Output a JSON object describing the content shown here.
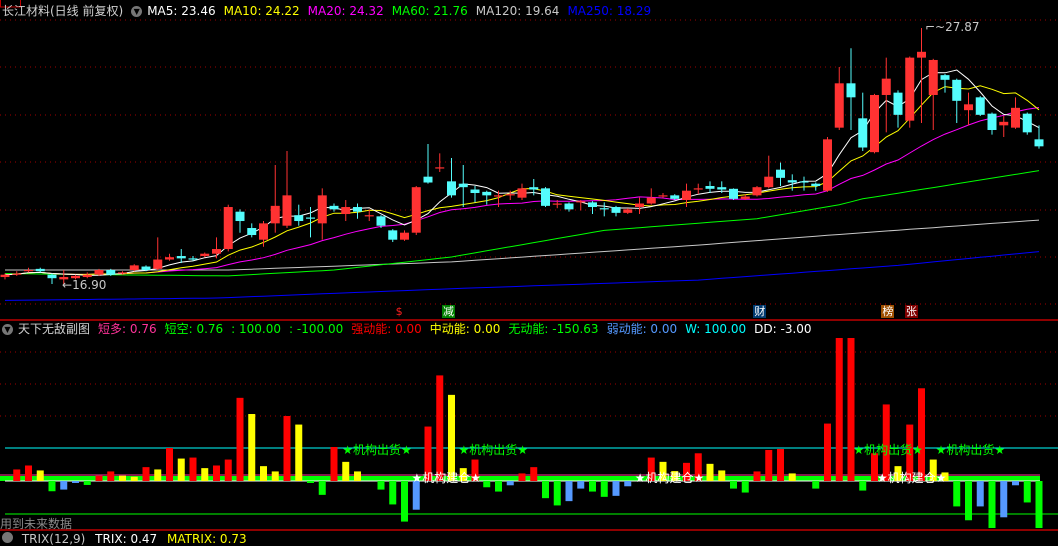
{
  "main": {
    "title": "长江材料(日线 前复权)",
    "ma": [
      {
        "label": "MA5: 23.46",
        "color": "#ffffff"
      },
      {
        "label": "MA10: 24.22",
        "color": "#ffff00"
      },
      {
        "label": "MA20: 24.32",
        "color": "#ff00ff"
      },
      {
        "label": "MA60: 21.76",
        "color": "#00ff00"
      },
      {
        "label": "MA120: 19.64",
        "color": "#c8c8c8"
      },
      {
        "label": "MA250: 18.29",
        "color": "#0000ff"
      }
    ],
    "high_label": "27.87",
    "low_label": "16.90",
    "high_index": 78,
    "high_value": 27.87,
    "low_index": 4,
    "low_value": 16.9,
    "price_range": [
      15.6,
      28.8
    ],
    "candles": [
      [
        17.2,
        17.3,
        17.35,
        17.1
      ],
      [
        17.3,
        17.35,
        17.45,
        17.25
      ],
      [
        17.45,
        17.5,
        17.6,
        17.4
      ],
      [
        17.55,
        17.45,
        17.6,
        17.4
      ],
      [
        17.3,
        17.15,
        17.35,
        16.9
      ],
      [
        17.1,
        17.2,
        17.5,
        16.9
      ],
      [
        17.15,
        17.25,
        17.3,
        17.1
      ],
      [
        17.2,
        17.3,
        17.4,
        17.15
      ],
      [
        17.3,
        17.5,
        17.55,
        17.25
      ],
      [
        17.5,
        17.3,
        17.55,
        17.25
      ],
      [
        17.35,
        17.4,
        17.45,
        17.3
      ],
      [
        17.5,
        17.7,
        17.75,
        17.45
      ],
      [
        17.65,
        17.5,
        17.7,
        17.45
      ],
      [
        17.55,
        17.95,
        18.9,
        17.5
      ],
      [
        17.95,
        18.05,
        18.2,
        17.9
      ],
      [
        18.1,
        18.0,
        18.4,
        17.8
      ],
      [
        18.0,
        17.95,
        18.1,
        17.9
      ],
      [
        18.1,
        18.2,
        18.25,
        18.05
      ],
      [
        18.2,
        18.4,
        18.9,
        18.0
      ],
      [
        18.4,
        20.2,
        20.3,
        18.3
      ],
      [
        20.0,
        19.6,
        20.1,
        19.1
      ],
      [
        19.3,
        19.0,
        19.5,
        18.9
      ],
      [
        18.8,
        19.5,
        19.6,
        18.5
      ],
      [
        19.5,
        20.25,
        22.0,
        19.1
      ],
      [
        19.4,
        20.7,
        22.6,
        19.3
      ],
      [
        19.85,
        19.6,
        20.3,
        19.4
      ],
      [
        19.75,
        19.7,
        20.2,
        18.9
      ],
      [
        19.5,
        20.7,
        21.0,
        18.8
      ],
      [
        20.25,
        20.1,
        20.35,
        20.0
      ],
      [
        19.9,
        20.2,
        20.5,
        19.6
      ],
      [
        20.2,
        20.0,
        20.35,
        19.7
      ],
      [
        19.8,
        19.85,
        20.1,
        19.6
      ],
      [
        19.8,
        19.4,
        19.85,
        19.3
      ],
      [
        19.2,
        18.8,
        19.25,
        18.7
      ],
      [
        18.8,
        19.1,
        19.2,
        18.75
      ],
      [
        19.1,
        21.05,
        21.1,
        19.0
      ],
      [
        21.5,
        21.25,
        22.9,
        21.2
      ],
      [
        21.85,
        21.9,
        22.5,
        21.7
      ],
      [
        21.3,
        20.7,
        22.3,
        20.6
      ],
      [
        21.2,
        21.05,
        22.0,
        20.2
      ],
      [
        20.95,
        20.8,
        21.1,
        20.4
      ],
      [
        20.85,
        20.7,
        20.9,
        20.3
      ],
      [
        20.65,
        20.7,
        20.9,
        20.2
      ],
      [
        20.7,
        20.75,
        20.9,
        20.5
      ],
      [
        20.6,
        21.0,
        21.2,
        20.5
      ],
      [
        21.05,
        20.95,
        21.4,
        20.7
      ],
      [
        21.0,
        20.25,
        21.05,
        20.2
      ],
      [
        20.3,
        20.35,
        20.5,
        20.15
      ],
      [
        20.35,
        20.1,
        20.4,
        20.0
      ],
      [
        20.4,
        20.45,
        20.5,
        20.05
      ],
      [
        20.4,
        20.2,
        20.45,
        19.9
      ],
      [
        20.15,
        20.1,
        20.4,
        19.8
      ],
      [
        20.2,
        19.95,
        20.25,
        19.8
      ],
      [
        19.95,
        20.1,
        20.15,
        19.9
      ],
      [
        20.2,
        20.35,
        20.6,
        19.9
      ],
      [
        20.35,
        20.6,
        21.0,
        20.3
      ],
      [
        20.65,
        20.7,
        20.8,
        20.6
      ],
      [
        20.7,
        20.55,
        20.75,
        20.5
      ],
      [
        20.5,
        20.9,
        21.2,
        20.2
      ],
      [
        20.95,
        21.0,
        21.2,
        20.75
      ],
      [
        21.1,
        20.98,
        21.3,
        20.8
      ],
      [
        21.05,
        20.95,
        21.3,
        20.8
      ],
      [
        20.98,
        20.55,
        21.0,
        20.5
      ],
      [
        20.55,
        20.65,
        20.75,
        20.5
      ],
      [
        20.7,
        21.05,
        21.1,
        20.65
      ],
      [
        21.05,
        21.5,
        22.4,
        21.0
      ],
      [
        21.8,
        21.45,
        22.1,
        21.1
      ],
      [
        21.35,
        21.25,
        21.6,
        20.9
      ],
      [
        21.3,
        21.25,
        21.5,
        20.9
      ],
      [
        21.2,
        21.1,
        21.25,
        20.9
      ],
      [
        20.9,
        23.1,
        23.2,
        20.85
      ],
      [
        23.6,
        25.5,
        26.2,
        23.5
      ],
      [
        25.5,
        24.9,
        27.0,
        23.5
      ],
      [
        24.0,
        22.75,
        25.1,
        22.6
      ],
      [
        22.55,
        25.0,
        25.05,
        22.5
      ],
      [
        25.0,
        25.7,
        26.6,
        23.4
      ],
      [
        25.1,
        24.15,
        25.2,
        23.6
      ],
      [
        23.9,
        26.6,
        26.65,
        23.6
      ],
      [
        26.6,
        26.85,
        27.87,
        23.8
      ],
      [
        25.0,
        26.5,
        26.55,
        23.5
      ],
      [
        25.85,
        25.65,
        25.9,
        25.1
      ],
      [
        25.65,
        24.75,
        25.7,
        23.8
      ],
      [
        24.35,
        24.6,
        25.1,
        23.7
      ],
      [
        24.9,
        24.15,
        24.95,
        24.1
      ],
      [
        24.2,
        23.5,
        24.25,
        23.3
      ],
      [
        23.7,
        23.85,
        24.1,
        23.2
      ],
      [
        23.6,
        24.45,
        24.9,
        23.55
      ],
      [
        24.2,
        23.4,
        24.25,
        23.3
      ],
      [
        23.1,
        22.8,
        23.7,
        22.7
      ]
    ],
    "ma60_points": [
      [
        0,
        17.35
      ],
      [
        8,
        17.3
      ],
      [
        19,
        17.25
      ],
      [
        28,
        17.5
      ],
      [
        38,
        18.06
      ],
      [
        51,
        19.2
      ],
      [
        64,
        19.7
      ],
      [
        71,
        20.3
      ],
      [
        73,
        20.55
      ],
      [
        88,
        21.76
      ]
    ],
    "ma120_points": [
      [
        0,
        17.5
      ],
      [
        19,
        17.5
      ],
      [
        38,
        17.85
      ],
      [
        59,
        18.57
      ],
      [
        73,
        19.1
      ],
      [
        88,
        19.64
      ]
    ],
    "ma250_points": [
      [
        0,
        16.2
      ],
      [
        18,
        16.3
      ],
      [
        38,
        16.7
      ],
      [
        59,
        17.07
      ],
      [
        76,
        17.7
      ],
      [
        88,
        18.29
      ]
    ],
    "markers": [
      {
        "index": 33.5,
        "text": "$",
        "bg": "#000000",
        "fg": "#ff2020"
      },
      {
        "index": 37.7,
        "text": "减",
        "bg": "#008000",
        "fg": "#ffffff"
      },
      {
        "index": 64.2,
        "text": "财",
        "bg": "#003a70",
        "fg": "#ffffff"
      },
      {
        "index": 75.1,
        "text": "榜",
        "bg": "#a05000",
        "fg": "#ffffff"
      },
      {
        "index": 77.1,
        "text": "张",
        "bg": "#800000",
        "fg": "#ffffff"
      }
    ]
  },
  "sub": {
    "icon": "chevron-down-icon",
    "title": "天下无敌副图",
    "legend": [
      {
        "label": "短多: 0.76",
        "color": "#ff3399"
      },
      {
        "label": "短空: 0.76",
        "color": "#00ff00"
      },
      {
        "label": ": 100.00",
        "color": "#00ff00"
      },
      {
        "label": ": -100.00",
        "color": "#00ff00"
      },
      {
        "label": "强动能: 0.00",
        "color": "#ff0000"
      },
      {
        "label": "中动能: 0.00",
        "color": "#ffff00"
      },
      {
        "label": "无动能: -150.63",
        "color": "#00ff00"
      },
      {
        "label": "弱动能: 0.00",
        "color": "#5599ff"
      },
      {
        "label": "W: 100.00",
        "color": "#00ffff"
      },
      {
        "label": "DD: -3.00",
        "color": "#ffffff"
      }
    ],
    "upper_line": 100,
    "lower_line": -100,
    "bar_colors": {
      "r": "#ff0000",
      "y": "#ffff00",
      "g": "#00ff00",
      "b": "#5599ff"
    },
    "bars": [
      [
        0,
        ""
      ],
      [
        35,
        "r"
      ],
      [
        47,
        "r"
      ],
      [
        32,
        "y"
      ],
      [
        -31,
        "g"
      ],
      [
        -26,
        "b"
      ],
      [
        -6,
        "b"
      ],
      [
        -12,
        "g"
      ],
      [
        16,
        "r"
      ],
      [
        29,
        "r"
      ],
      [
        16,
        "y"
      ],
      [
        13,
        "y"
      ],
      [
        42,
        "r"
      ],
      [
        35,
        "y"
      ],
      [
        100,
        "r"
      ],
      [
        68,
        "y"
      ],
      [
        71,
        "r"
      ],
      [
        39,
        "y"
      ],
      [
        47,
        "r"
      ],
      [
        65,
        "r"
      ],
      [
        252,
        "r"
      ],
      [
        203,
        "y"
      ],
      [
        45,
        "y"
      ],
      [
        29,
        "y"
      ],
      [
        197,
        "r"
      ],
      [
        171,
        "y"
      ],
      [
        -6,
        "g"
      ],
      [
        -42,
        "g"
      ],
      [
        103,
        "r"
      ],
      [
        58,
        "y"
      ],
      [
        29,
        "y"
      ],
      [
        0,
        ""
      ],
      [
        -26,
        "g"
      ],
      [
        -71,
        "g"
      ],
      [
        -123,
        "g"
      ],
      [
        -87,
        "b"
      ],
      [
        165,
        "r"
      ],
      [
        320,
        "r"
      ],
      [
        261,
        "y"
      ],
      [
        39,
        "y"
      ],
      [
        65,
        "r"
      ],
      [
        -19,
        "g"
      ],
      [
        -32,
        "g"
      ],
      [
        -13,
        "b"
      ],
      [
        23,
        "r"
      ],
      [
        42,
        "r"
      ],
      [
        -52,
        "g"
      ],
      [
        -74,
        "g"
      ],
      [
        -61,
        "b"
      ],
      [
        -23,
        "b"
      ],
      [
        -32,
        "g"
      ],
      [
        -48,
        "g"
      ],
      [
        -45,
        "b"
      ],
      [
        -16,
        "b"
      ],
      [
        0,
        ""
      ],
      [
        71,
        "r"
      ],
      [
        58,
        "y"
      ],
      [
        30,
        "y"
      ],
      [
        55,
        "r"
      ],
      [
        84,
        "r"
      ],
      [
        52,
        "y"
      ],
      [
        32,
        "y"
      ],
      [
        -23,
        "g"
      ],
      [
        -35,
        "g"
      ],
      [
        29,
        "r"
      ],
      [
        94,
        "r"
      ],
      [
        97,
        "r"
      ],
      [
        23,
        "y"
      ],
      [
        0,
        ""
      ],
      [
        -23,
        "g"
      ],
      [
        174,
        "r"
      ],
      [
        452,
        "r"
      ],
      [
        455,
        "r"
      ],
      [
        -29,
        "g"
      ],
      [
        84,
        "r"
      ],
      [
        232,
        "r"
      ],
      [
        45,
        "y"
      ],
      [
        171,
        "r"
      ],
      [
        281,
        "r"
      ],
      [
        65,
        "y"
      ],
      [
        26,
        "y"
      ],
      [
        -77,
        "g"
      ],
      [
        -119,
        "g"
      ],
      [
        -77,
        "b"
      ],
      [
        -155,
        "g"
      ],
      [
        -110,
        "b"
      ],
      [
        -13,
        "b"
      ],
      [
        -65,
        "g"
      ],
      [
        -155,
        "g"
      ]
    ],
    "signals": [
      {
        "index": 28.7,
        "text": "★机构出货★",
        "color": "#00ff00",
        "type": "sell"
      },
      {
        "index": 38.6,
        "text": "★机构出货★",
        "color": "#00ff00",
        "type": "sell"
      },
      {
        "index": 72.2,
        "text": "★机构出货★",
        "color": "#00ff00",
        "type": "sell"
      },
      {
        "index": 79.2,
        "text": "★机构出货★",
        "color": "#00ff00",
        "type": "sell"
      },
      {
        "index": 34.6,
        "text": "★机构建仓★",
        "color": "#ffffff",
        "type": "buy"
      },
      {
        "index": 53.6,
        "text": "★机构建仓★",
        "color": "#ffffff",
        "type": "buy"
      },
      {
        "index": 74.2,
        "text": "★机构建仓★",
        "color": "#ffffff",
        "type": "buy"
      }
    ],
    "warning": "用到未来数据"
  },
  "trix": {
    "label": "TRIX(12,9)",
    "trix": "TRIX: 0.47",
    "matrix": "MATRIX: 0.73"
  }
}
